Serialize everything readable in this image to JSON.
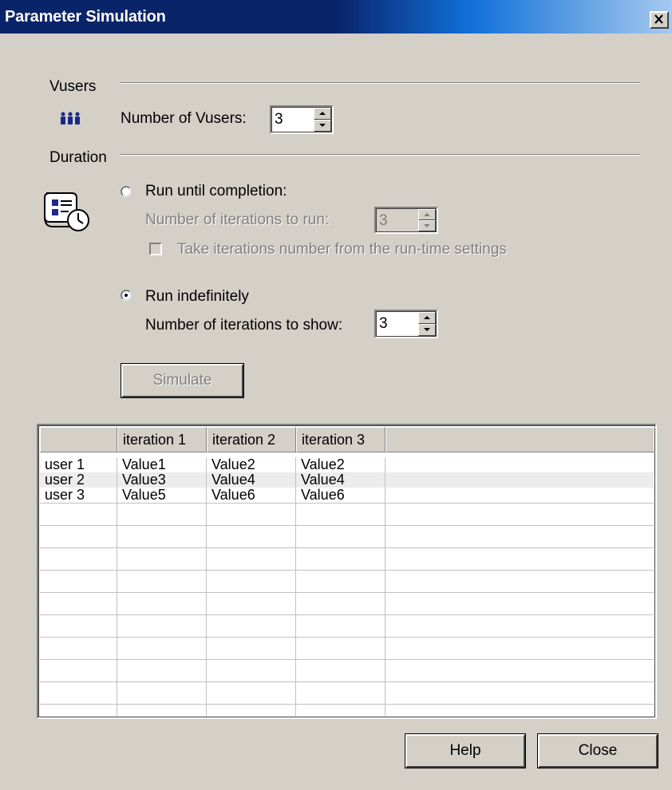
{
  "window": {
    "title": "Parameter Simulation"
  },
  "vusers": {
    "group_label": "Vusers",
    "count_label": "Number of Vusers:",
    "count_value": "3"
  },
  "duration": {
    "group_label": "Duration",
    "run_until_completion_label": "Run until completion:",
    "iterations_to_run_label": "Number of iterations to run:",
    "iterations_to_run_value": "3",
    "take_iterations_label": "Take iterations number from the run-time settings",
    "run_indefinitely_label": "Run indefinitely",
    "iterations_to_show_label": "Number of iterations to show:",
    "iterations_to_show_value": "3",
    "selected_mode": "run_indefinitely"
  },
  "simulate_button": "Simulate",
  "grid": {
    "columns": [
      "",
      "iteration 1",
      "iteration 2",
      "iteration 3",
      ""
    ],
    "rows": [
      [
        "user 1",
        "Value1",
        "Value2",
        "Value2"
      ],
      [
        "user 2",
        "Value3",
        "Value4",
        "Value4"
      ],
      [
        "user 3",
        "Value5",
        "Value6",
        "Value6"
      ]
    ]
  },
  "buttons": {
    "help": "Help",
    "close": "Close"
  },
  "icons": {
    "vusers": "users-icon",
    "duration": "script-clock-icon",
    "close": "close-icon"
  }
}
